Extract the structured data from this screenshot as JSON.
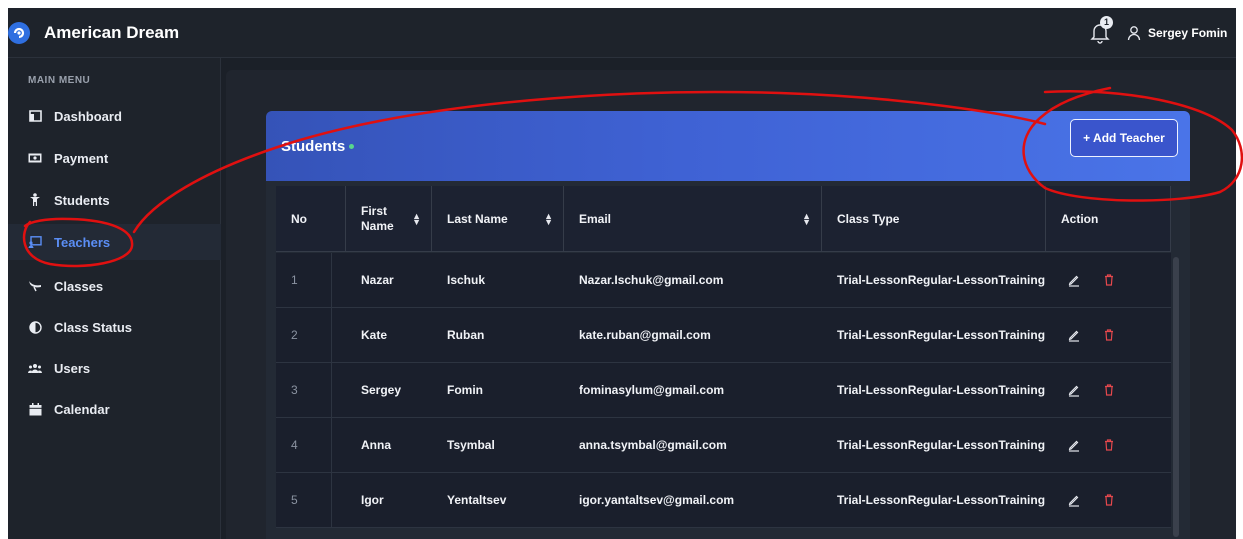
{
  "app": {
    "title": "American Dream"
  },
  "header": {
    "notification_count": "1",
    "user_name": "Sergey Fomin"
  },
  "sidebar": {
    "menu_title": "MAIN MENU",
    "items": [
      {
        "label": "Dashboard",
        "icon": "dashboard-icon"
      },
      {
        "label": "Payment",
        "icon": "payment-icon"
      },
      {
        "label": "Students",
        "icon": "students-icon"
      },
      {
        "label": "Teachers",
        "icon": "teachers-icon",
        "active": true
      },
      {
        "label": "Classes",
        "icon": "classes-icon"
      },
      {
        "label": "Class Status",
        "icon": "class-status-icon"
      },
      {
        "label": "Users",
        "icon": "users-icon"
      },
      {
        "label": "Calendar",
        "icon": "calendar-icon"
      }
    ]
  },
  "card": {
    "title": "Students",
    "add_button": "+ Add Teacher"
  },
  "table": {
    "headers": [
      "No",
      "First Name",
      "Last Name",
      "Email",
      "Class Type",
      "Action"
    ],
    "rows": [
      {
        "no": "1",
        "first": "Nazar",
        "last": "Ischuk",
        "email": "Nazar.Ischuk@gmail.com",
        "class_type": "Trial-LessonRegular-LessonTraining"
      },
      {
        "no": "2",
        "first": "Kate",
        "last": "Ruban",
        "email": "kate.ruban@gmail.com",
        "class_type": "Trial-LessonRegular-LessonTraining"
      },
      {
        "no": "3",
        "first": "Sergey",
        "last": "Fomin",
        "email": "fominasylum@gmail.com",
        "class_type": "Trial-LessonRegular-LessonTraining"
      },
      {
        "no": "4",
        "first": "Anna",
        "last": "Tsymbal",
        "email": "anna.tsymbal@gmail.com",
        "class_type": "Trial-LessonRegular-LessonTraining"
      },
      {
        "no": "5",
        "first": "Igor",
        "last": "Yentaltsev",
        "email": "igor.yantaltsev@gmail.com",
        "class_type": "Trial-LessonRegular-LessonTraining"
      }
    ]
  },
  "colors": {
    "accent": "#5b8ef5",
    "header_gradient_start": "#3553b8",
    "header_gradient_end": "#4a74e8",
    "delete": "#e5484d",
    "annotation": "#e01010",
    "status_dot": "#58d68d"
  }
}
